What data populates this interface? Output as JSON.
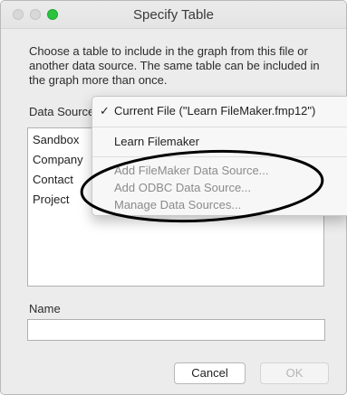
{
  "window": {
    "title": "Specify Table"
  },
  "dialog": {
    "instructions": "Choose a table to include in the graph from this file or another data source.  The same table can be included in the graph more than once.",
    "data_source_label": "Data Source",
    "tables": [
      "Sandbox",
      "Company",
      "Contact",
      "Project"
    ],
    "name_label": "Name",
    "name_value": "",
    "cancel_label": "Cancel",
    "ok_label": "OK"
  },
  "menu": {
    "check_glyph": "✓",
    "items": [
      {
        "label": "Current File (\"Learn FileMaker.fmp12\")",
        "checked": true,
        "enabled": true
      },
      {
        "label": "Learn Filemaker",
        "checked": false,
        "enabled": true
      },
      {
        "label": "Add FileMaker Data Source...",
        "checked": false,
        "enabled": false
      },
      {
        "label": "Add ODBC Data Source...",
        "checked": false,
        "enabled": false
      },
      {
        "label": "Manage Data Sources...",
        "checked": false,
        "enabled": false
      }
    ]
  },
  "colors": {
    "zoom_button": "#2ac33f",
    "annotation_ellipse": "#000000"
  }
}
